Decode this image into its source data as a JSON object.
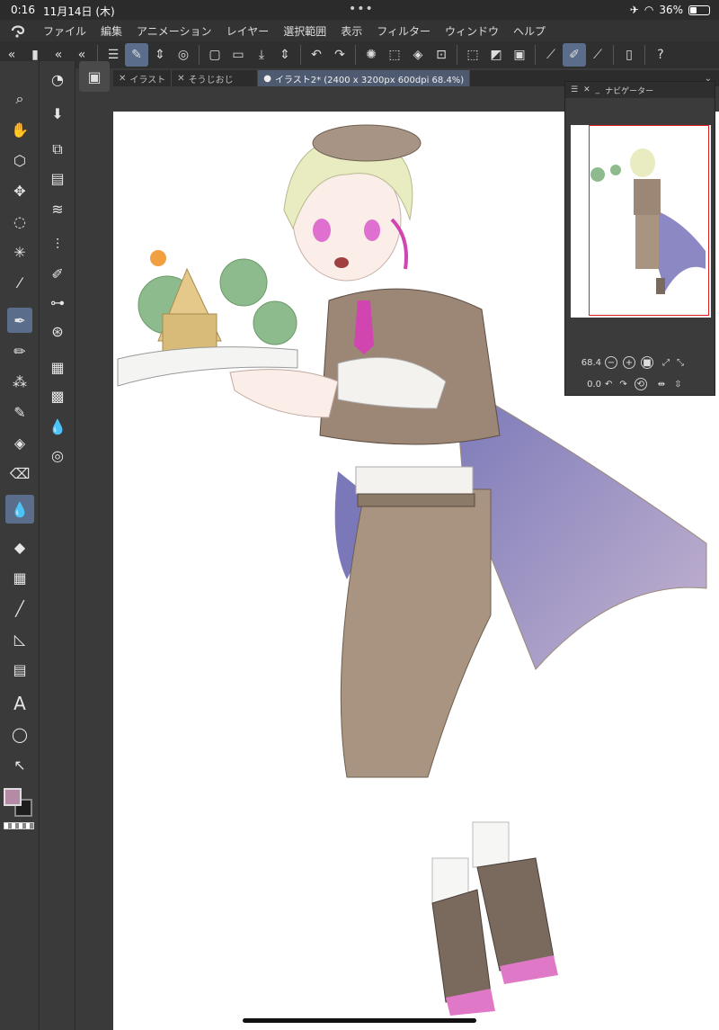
{
  "status": {
    "time": "0:16",
    "date": "11月14日 (木)",
    "dots": "•••",
    "battery": "36%",
    "battery_level": 0.36
  },
  "menu": {
    "items": [
      "ファイル",
      "編集",
      "アニメーション",
      "レイヤー",
      "選択範囲",
      "表示",
      "フィルター",
      "ウィンドウ",
      "ヘルプ"
    ]
  },
  "tabs": [
    {
      "label": "イラスト",
      "active": false
    },
    {
      "label": "そうじおじ",
      "active": false
    },
    {
      "label": "イラスト2* (2400 x 3200px 600dpi 68.4%)",
      "active": true
    }
  ],
  "navigator": {
    "title": "ナビゲーター",
    "zoom": "68.4",
    "rotation": "0.0"
  },
  "colors": {
    "main_color": "#b48aa4",
    "sub_color": "#1e1e1e",
    "accent": "#5a6e8c"
  }
}
